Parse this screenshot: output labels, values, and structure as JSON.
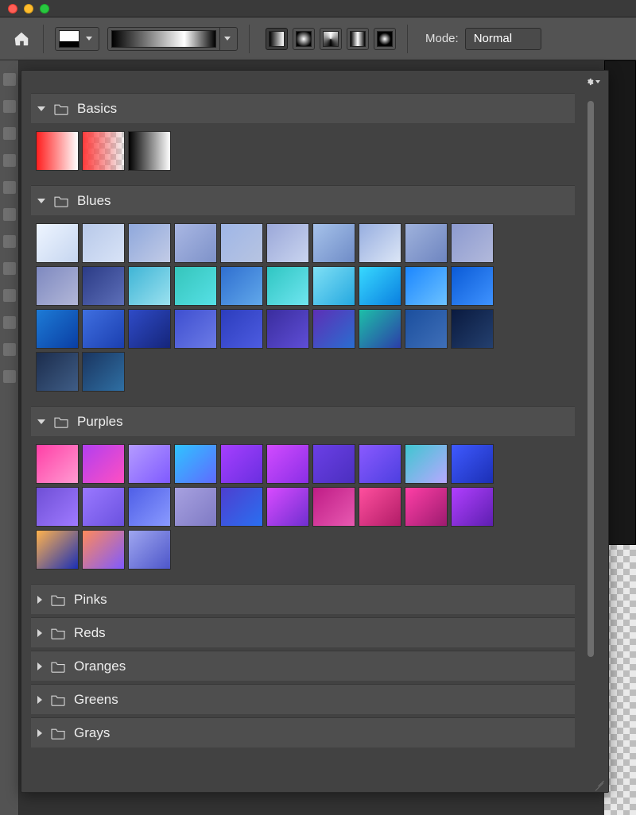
{
  "titlebar": {
    "title": ""
  },
  "optionsbar": {
    "mode_label": "Mode:",
    "mode_value": "Normal",
    "gradient_types": [
      "Linear",
      "Radial",
      "Angle",
      "Reflected",
      "Diamond"
    ],
    "active_type_index": 0
  },
  "picker": {
    "folders": [
      {
        "name": "Basics",
        "expanded": true,
        "swatches": [
          {
            "css": "linear-gradient(90deg,#ff1e1e,#ffffff)"
          },
          {
            "css": "linear-gradient(90deg,#ff3b3b,rgba(255,59,59,0))",
            "transparent": true
          },
          {
            "css": "linear-gradient(90deg,#000000,#ffffff)"
          }
        ]
      },
      {
        "name": "Blues",
        "expanded": true,
        "swatches": [
          {
            "css": "linear-gradient(135deg,#eef5ff,#c6d6f0)"
          },
          {
            "css": "linear-gradient(135deg,#b8c9e9,#d8e3f7)"
          },
          {
            "css": "linear-gradient(135deg,#8fa8dc,#c2cbe6)"
          },
          {
            "css": "linear-gradient(135deg,#a9b7e3,#7e92c9)"
          },
          {
            "css": "linear-gradient(135deg,#9fb6e7,#b7c4e1)"
          },
          {
            "css": "linear-gradient(135deg,#9ba8d9,#c9d4ef)"
          },
          {
            "css": "linear-gradient(135deg,#a6c2ea,#6f8cc7)"
          },
          {
            "css": "linear-gradient(135deg,#97aee0,#dce6f6)"
          },
          {
            "css": "linear-gradient(135deg,#9fb2dc,#6e85c0)"
          },
          {
            "css": "linear-gradient(135deg,#8c9ad0,#b2b9db)"
          },
          {
            "css": "linear-gradient(135deg,#7e89c0,#b2b7d8)"
          },
          {
            "css": "linear-gradient(135deg,#2b3b86,#5d6fb8)"
          },
          {
            "css": "linear-gradient(135deg,#3fb5d6,#9be1ef)"
          },
          {
            "css": "linear-gradient(135deg,#35c5bb,#56e0e6)"
          },
          {
            "css": "linear-gradient(135deg,#2f6fd0,#61a8ea)"
          },
          {
            "css": "linear-gradient(135deg,#2fc6c2,#6fe5f0)"
          },
          {
            "css": "linear-gradient(135deg,#7fe0f5,#25a8e0)"
          },
          {
            "css": "linear-gradient(135deg,#38d9ff,#0a7fe0)"
          },
          {
            "css": "linear-gradient(135deg,#1b86ff,#6cc2ff)"
          },
          {
            "css": "linear-gradient(135deg,#0a5ad6,#3f93ff)"
          },
          {
            "css": "linear-gradient(135deg,#1d7bd6,#0a3ea3)"
          },
          {
            "css": "linear-gradient(135deg,#3f6fe0,#1b3fb0)"
          },
          {
            "css": "linear-gradient(135deg,#2f4bc7,#15257a)"
          },
          {
            "css": "linear-gradient(135deg,#3e4fd0,#6c7be6)"
          },
          {
            "css": "linear-gradient(135deg,#2c3dbd,#4d5ce0)"
          },
          {
            "css": "linear-gradient(135deg,#3a2d9e,#5f4ed6)"
          },
          {
            "css": "linear-gradient(135deg,#5d2fb6,#2a6ed0)"
          },
          {
            "css": "linear-gradient(135deg,#1dbfa8,#2c3ea8)"
          },
          {
            "css": "linear-gradient(135deg,#1b4f9e,#3f6fb8)"
          },
          {
            "css": "linear-gradient(135deg,#0a1a3f,#24406f)"
          },
          {
            "css": "linear-gradient(135deg,#1c2d4d,#3f5d86)"
          },
          {
            "css": "linear-gradient(135deg,#1a3560,#2f6fa3)"
          }
        ]
      },
      {
        "name": "Purples",
        "expanded": true,
        "swatches": [
          {
            "css": "linear-gradient(135deg,#ff3fa6,#ff9bd2)"
          },
          {
            "css": "linear-gradient(135deg,#b13ff0,#ff4fc2)"
          },
          {
            "css": "linear-gradient(135deg,#b59bff,#7f5aff)"
          },
          {
            "css": "linear-gradient(135deg,#2fc4ff,#5f6aff)"
          },
          {
            "css": "linear-gradient(135deg,#a63fff,#6a2fe0)"
          },
          {
            "css": "linear-gradient(135deg,#d24bff,#8a2fe6)"
          },
          {
            "css": "linear-gradient(135deg,#6b3fe6,#4b2fbf)"
          },
          {
            "css": "linear-gradient(135deg,#8a5aff,#4d3fe0)"
          },
          {
            "css": "linear-gradient(135deg,#3fc6d0,#b7a8ff)"
          },
          {
            "css": "linear-gradient(135deg,#3f5aff,#1b2fb5)"
          },
          {
            "css": "linear-gradient(135deg,#6f4fd6,#9f7aff)"
          },
          {
            "css": "linear-gradient(135deg,#9a78ff,#6b52e0)"
          },
          {
            "css": "linear-gradient(135deg,#4f5fe7,#8a9aff)"
          },
          {
            "css": "linear-gradient(135deg,#a7a1e0,#7f7ac4)"
          },
          {
            "css": "linear-gradient(135deg,#4d3fd0,#2a6ff0)"
          },
          {
            "css": "linear-gradient(135deg,#d94bff,#6f2fd0)"
          },
          {
            "css": "linear-gradient(135deg,#bf1c86,#e85ab1)"
          },
          {
            "css": "linear-gradient(135deg,#ff4f9e,#b11c67)"
          },
          {
            "css": "linear-gradient(135deg,#ff3fa6,#9c1b6f)"
          },
          {
            "css": "linear-gradient(135deg,#b13fff,#5d1fb0)"
          },
          {
            "css": "linear-gradient(135deg,#ffb24d,#1b2fb5)"
          },
          {
            "css": "linear-gradient(135deg,#ff8a5a,#7f5aff)"
          },
          {
            "css": "linear-gradient(135deg,#9fa6f0,#4d56c9)"
          }
        ]
      },
      {
        "name": "Pinks",
        "expanded": false,
        "swatches": []
      },
      {
        "name": "Reds",
        "expanded": false,
        "swatches": []
      },
      {
        "name": "Oranges",
        "expanded": false,
        "swatches": []
      },
      {
        "name": "Greens",
        "expanded": false,
        "swatches": []
      },
      {
        "name": "Grays",
        "expanded": false,
        "swatches": []
      }
    ]
  }
}
